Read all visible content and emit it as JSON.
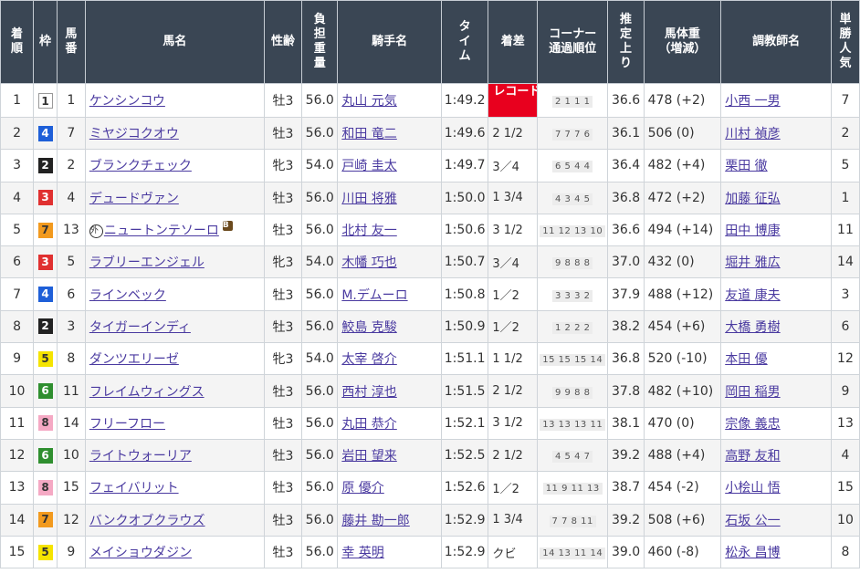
{
  "headers": {
    "rank": "着順",
    "waku": "枠",
    "umaban": "馬番",
    "name": "馬名",
    "sexage": "性齢",
    "weight": "負担重量",
    "jockey": "騎手名",
    "time": "タイム",
    "margin": "着差",
    "corner": "コーナー通過順位",
    "last3f": "推定上り",
    "bodyweight": "馬体重(増減)",
    "trainer": "調教師名",
    "popularity": "単勝人気"
  },
  "colors": {
    "header_bg": "#3a4654",
    "link": "#4a3aa0",
    "record_badge": "#e8001e",
    "waku_1": "#ffffff",
    "waku_2": "#222222",
    "waku_3": "#e03030",
    "waku_4": "#1e5fd8",
    "waku_5": "#f5e400",
    "waku_6": "#2f8f2f",
    "waku_7": "#f29a1e",
    "waku_8": "#f5a9c4",
    "blinker_tag": "#6b4a1e"
  },
  "rows": [
    {
      "rank": "1",
      "waku": "1",
      "umaban": "1",
      "name": "ケンシンコウ",
      "sexage": "牡3",
      "weight": "56.0",
      "jockey": "丸山 元気",
      "time": "1:49.2",
      "margin": "レコード",
      "corner": "2 1 1 1",
      "last3f": "36.6",
      "bodyweight": "478 (+2)",
      "trainer": "小西 一男",
      "popularity": "7",
      "record": true
    },
    {
      "rank": "2",
      "waku": "4",
      "umaban": "7",
      "name": "ミヤジコクオウ",
      "sexage": "牡3",
      "weight": "56.0",
      "jockey": "和田 竜二",
      "time": "1:49.6",
      "margin": "2 1/2",
      "corner": "7 7 7 6",
      "last3f": "36.1",
      "bodyweight": "506 (0)",
      "trainer": "川村 禎彦",
      "popularity": "2"
    },
    {
      "rank": "3",
      "waku": "2",
      "umaban": "2",
      "name": "ブランクチェック",
      "sexage": "牝3",
      "weight": "54.0",
      "jockey": "戸崎 圭太",
      "time": "1:49.7",
      "margin": "3／4",
      "corner": "6 5 4 4",
      "last3f": "36.4",
      "bodyweight": "482 (+4)",
      "trainer": "栗田 徹",
      "popularity": "5"
    },
    {
      "rank": "4",
      "waku": "3",
      "umaban": "4",
      "name": "デュードヴァン",
      "sexage": "牡3",
      "weight": "56.0",
      "jockey": "川田 将雅",
      "time": "1:50.0",
      "margin": "1 3/4",
      "corner": "4 3 4 5",
      "last3f": "36.8",
      "bodyweight": "472 (+2)",
      "trainer": "加藤 征弘",
      "popularity": "1"
    },
    {
      "rank": "5",
      "waku": "7",
      "umaban": "13",
      "name": "ニュートンテソーロ",
      "sexage": "牡3",
      "weight": "56.0",
      "jockey": "北村 友一",
      "time": "1:50.6",
      "margin": "3 1/2",
      "corner": "11 12 13 10",
      "last3f": "36.6",
      "bodyweight": "494 (+14)",
      "trainer": "田中 博康",
      "popularity": "11",
      "gai": "外",
      "tag": "B"
    },
    {
      "rank": "6",
      "waku": "3",
      "umaban": "5",
      "name": "ラブリーエンジェル",
      "sexage": "牝3",
      "weight": "54.0",
      "jockey": "木幡 巧也",
      "time": "1:50.7",
      "margin": "3／4",
      "corner": "9 8 8 8",
      "last3f": "37.0",
      "bodyweight": "432 (0)",
      "trainer": "堀井 雅広",
      "popularity": "14"
    },
    {
      "rank": "7",
      "waku": "4",
      "umaban": "6",
      "name": "ラインベック",
      "sexage": "牡3",
      "weight": "56.0",
      "jockey": "M.デムーロ",
      "time": "1:50.8",
      "margin": "1／2",
      "corner": "3 3 3 2",
      "last3f": "37.9",
      "bodyweight": "488 (+12)",
      "trainer": "友道 康夫",
      "popularity": "3"
    },
    {
      "rank": "8",
      "waku": "2",
      "umaban": "3",
      "name": "タイガーインディ",
      "sexage": "牡3",
      "weight": "56.0",
      "jockey": "鮫島 克駿",
      "time": "1:50.9",
      "margin": "1／2",
      "corner": "1 2 2 2",
      "last3f": "38.2",
      "bodyweight": "454 (+6)",
      "trainer": "大橋 勇樹",
      "popularity": "6"
    },
    {
      "rank": "9",
      "waku": "5",
      "umaban": "8",
      "name": "ダンツエリーゼ",
      "sexage": "牝3",
      "weight": "54.0",
      "jockey": "太宰 啓介",
      "time": "1:51.1",
      "margin": "1 1/2",
      "corner": "15 15 15 14",
      "last3f": "36.8",
      "bodyweight": "520 (-10)",
      "trainer": "本田 優",
      "popularity": "12"
    },
    {
      "rank": "10",
      "waku": "6",
      "umaban": "11",
      "name": "フレイムウィングス",
      "sexage": "牡3",
      "weight": "56.0",
      "jockey": "西村 淳也",
      "time": "1:51.5",
      "margin": "2 1/2",
      "corner": "9 9 8 8",
      "last3f": "37.8",
      "bodyweight": "482 (+10)",
      "trainer": "岡田 稲男",
      "popularity": "9"
    },
    {
      "rank": "11",
      "waku": "8",
      "umaban": "14",
      "name": "フリーフロー",
      "sexage": "牡3",
      "weight": "56.0",
      "jockey": "丸田 恭介",
      "time": "1:52.1",
      "margin": "3 1/2",
      "corner": "13 13 13 11",
      "last3f": "38.1",
      "bodyweight": "470 (0)",
      "trainer": "宗像 義忠",
      "popularity": "13"
    },
    {
      "rank": "12",
      "waku": "6",
      "umaban": "10",
      "name": "ライトウォーリア",
      "sexage": "牡3",
      "weight": "56.0",
      "jockey": "岩田 望来",
      "time": "1:52.5",
      "margin": "2 1/2",
      "corner": "4 5 4 7",
      "last3f": "39.2",
      "bodyweight": "488 (+4)",
      "trainer": "高野 友和",
      "popularity": "4"
    },
    {
      "rank": "13",
      "waku": "8",
      "umaban": "15",
      "name": "フェイバリット",
      "sexage": "牡3",
      "weight": "56.0",
      "jockey": "原 優介",
      "time": "1:52.6",
      "margin": "1／2",
      "corner": "11 9 11 13",
      "last3f": "38.7",
      "bodyweight": "454 (-2)",
      "trainer": "小桧山 悟",
      "popularity": "15"
    },
    {
      "rank": "14",
      "waku": "7",
      "umaban": "12",
      "name": "バンクオブクラウズ",
      "sexage": "牡3",
      "weight": "56.0",
      "jockey": "藤井 勘一郎",
      "time": "1:52.9",
      "margin": "1 3/4",
      "corner": "7 7 8 11",
      "last3f": "39.2",
      "bodyweight": "508 (+6)",
      "trainer": "石坂 公一",
      "popularity": "10"
    },
    {
      "rank": "15",
      "waku": "5",
      "umaban": "9",
      "name": "メイショウダジン",
      "sexage": "牡3",
      "weight": "56.0",
      "jockey": "幸 英明",
      "time": "1:52.9",
      "margin": "クビ",
      "corner": "14 13 11 14",
      "last3f": "39.0",
      "bodyweight": "460 (-8)",
      "trainer": "松永 昌博",
      "popularity": "8"
    }
  ]
}
